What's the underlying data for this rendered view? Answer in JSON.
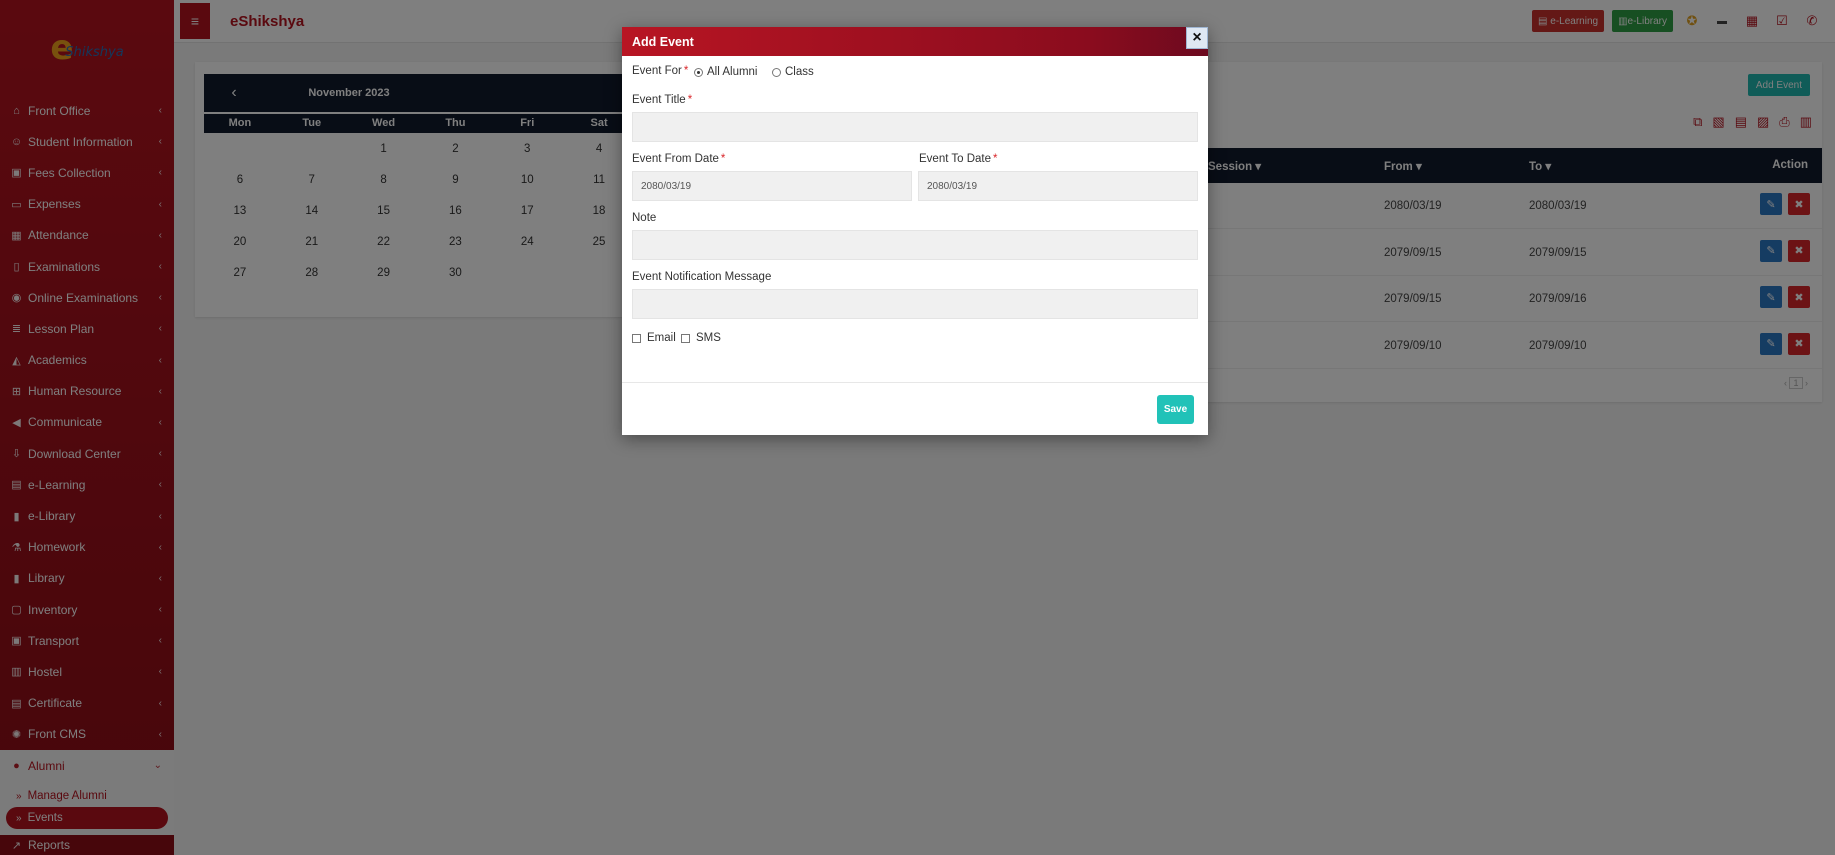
{
  "app": {
    "brand": "eShikshya",
    "logo_text": "Shikshya"
  },
  "header": {
    "elearning_label": "e-Learning",
    "elibrary_label": "e-Library"
  },
  "sidebar": {
    "items": [
      {
        "label": "Front Office",
        "icon": "desk-icon"
      },
      {
        "label": "Student Information",
        "icon": "user-icon"
      },
      {
        "label": "Fees Collection",
        "icon": "money-icon"
      },
      {
        "label": "Expenses",
        "icon": "credit-card-icon"
      },
      {
        "label": "Attendance",
        "icon": "calendar-check-icon"
      },
      {
        "label": "Examinations",
        "icon": "map-icon"
      },
      {
        "label": "Online Examinations",
        "icon": "rss-icon"
      },
      {
        "label": "Lesson Plan",
        "icon": "list-icon"
      },
      {
        "label": "Academics",
        "icon": "graduation-cap-icon"
      },
      {
        "label": "Human Resource",
        "icon": "sitemap-icon"
      },
      {
        "label": "Communicate",
        "icon": "bullhorn-icon"
      },
      {
        "label": "Download Center",
        "icon": "download-icon"
      },
      {
        "label": "e-Learning",
        "icon": "film-icon"
      },
      {
        "label": "e-Library",
        "icon": "book-icon"
      },
      {
        "label": "Homework",
        "icon": "flask-icon"
      },
      {
        "label": "Library",
        "icon": "book-icon"
      },
      {
        "label": "Inventory",
        "icon": "object-group-icon"
      },
      {
        "label": "Transport",
        "icon": "bus-icon"
      },
      {
        "label": "Hostel",
        "icon": "building-icon"
      },
      {
        "label": "Certificate",
        "icon": "newspaper-icon"
      },
      {
        "label": "Front CMS",
        "icon": "empire-icon"
      }
    ],
    "active": {
      "label": "Alumni",
      "icon": "info-circle-icon"
    },
    "subitems": [
      "Manage Alumni",
      "Events"
    ],
    "after": {
      "label": "Reports",
      "icon": "line-chart-icon"
    }
  },
  "calendar": {
    "month": "November 2023",
    "weekdays": [
      "Mon",
      "Tue",
      "Wed",
      "Thu",
      "Fri",
      "Sat"
    ],
    "weeks": [
      [
        "",
        "",
        "1",
        "2",
        "3",
        "4"
      ],
      [
        "6",
        "7",
        "8",
        "9",
        "10",
        "11"
      ],
      [
        "13",
        "14",
        "15",
        "16",
        "17",
        "18"
      ],
      [
        "20",
        "21",
        "22",
        "23",
        "24",
        "25"
      ],
      [
        "27",
        "28",
        "29",
        "30",
        "",
        ""
      ]
    ]
  },
  "events_list": {
    "add_label": "Add Event",
    "columns": {
      "session": "Session",
      "from": "From",
      "to": "To",
      "action": "Action"
    },
    "rows": [
      {
        "from": "2080/03/19",
        "to": "2080/03/19"
      },
      {
        "from": "2079/09/15",
        "to": "2079/09/15"
      },
      {
        "from": "2079/09/15",
        "to": "2079/09/16"
      },
      {
        "from": "2079/09/10",
        "to": "2079/09/10"
      }
    ],
    "page": "1"
  },
  "modal": {
    "title": "Add Event",
    "event_for_label": "Event For",
    "option_all": "All Alumni",
    "option_class": "Class",
    "title_label": "Event Title",
    "title_value": "",
    "from_label": "Event From Date",
    "from_value": "2080/03/19",
    "to_label": "Event To Date",
    "to_value": "2080/03/19",
    "note_label": "Note",
    "note_value": "",
    "message_label": "Event Notification Message",
    "message_value": "",
    "email_label": "Email",
    "sms_label": "SMS",
    "save_label": "Save",
    "close_glyph": "×"
  },
  "colors": {
    "brand_red": "#b5131f",
    "navy": "#111a2c",
    "teal": "#21c2b8"
  }
}
